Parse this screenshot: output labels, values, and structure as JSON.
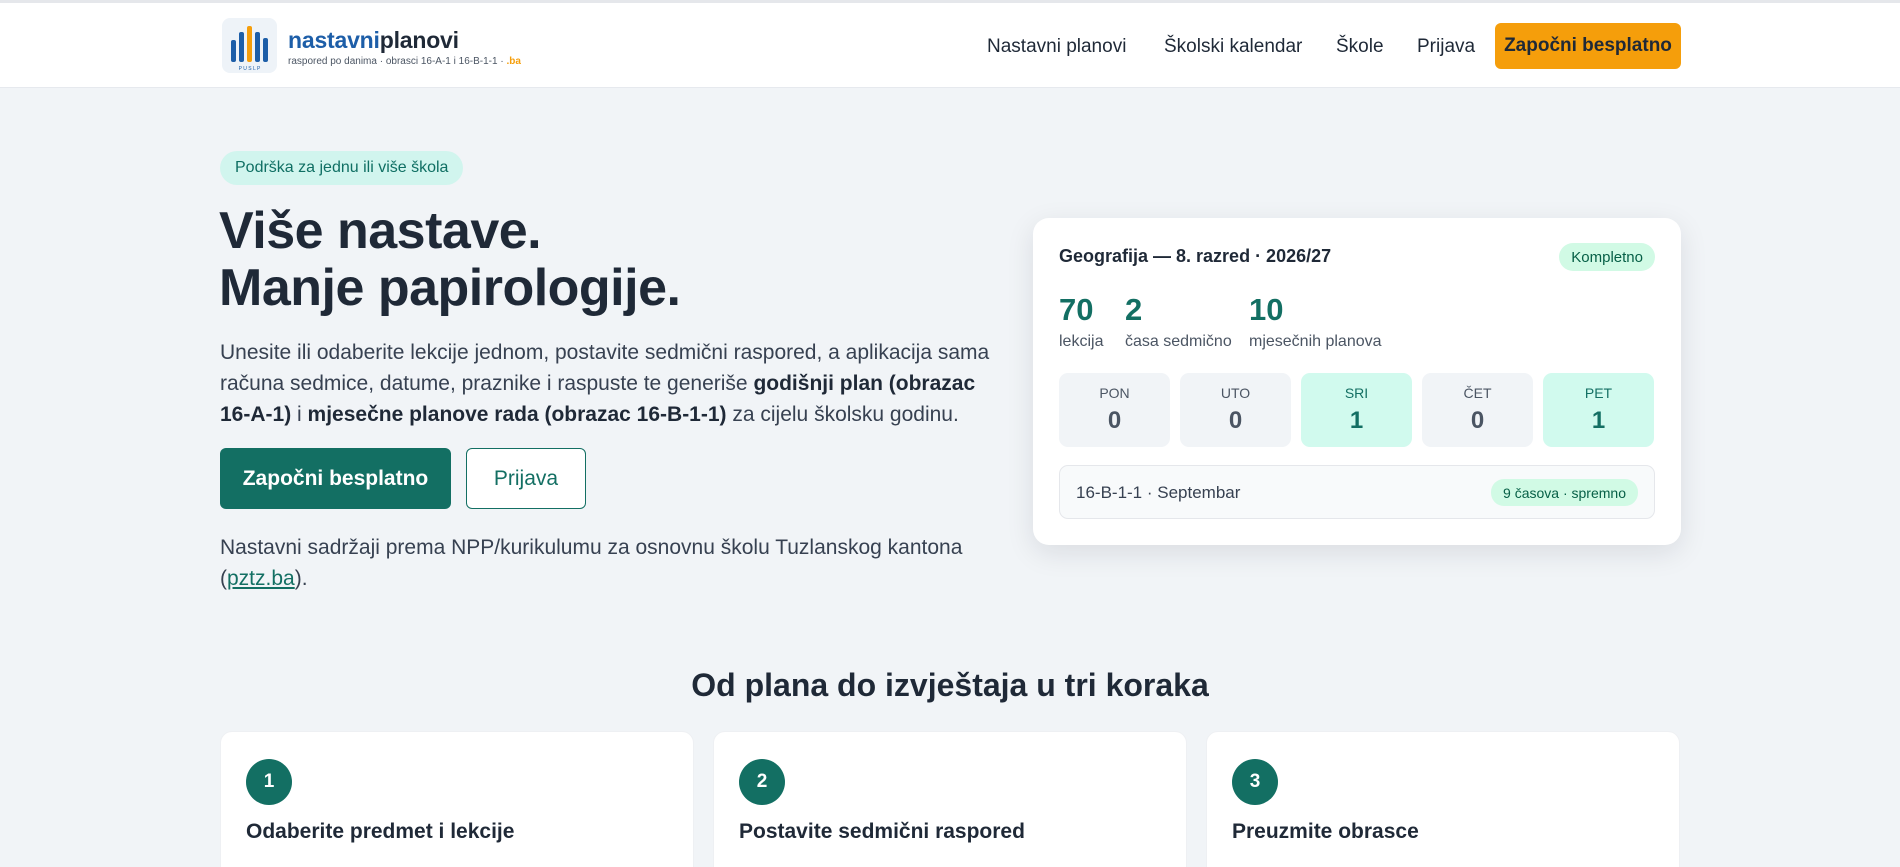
{
  "header": {
    "brand_part1": "nastavni",
    "brand_part2": "planovi",
    "brand_sub": "raspored po danima · obrasci 16-A-1 i 16-B-1-1 ·",
    "brand_tld": ".ba",
    "logo_caption": "P U S L P",
    "nav": [
      "Nastavni planovi",
      "Školski kalendar",
      "Škole",
      "Prijava"
    ],
    "cta": "Započni besplatno"
  },
  "hero": {
    "pill": "Podrška za jednu ili više škola",
    "title_line1": "Više nastave.",
    "title_line2": "Manje papirologije.",
    "desc_part1": "Unesite ili odaberite lekcije jednom, postavite sedmični raspored, a aplikacija sama računa sedmice, datume, praznike i raspuste te generiše ",
    "desc_bold1": "godišnji plan (obrazac 16-A-1)",
    "desc_part2": " i ",
    "desc_bold2": "mjesečne planove rada (obrazac 16-B-1-1)",
    "desc_part3": " za cijelu školsku godinu.",
    "btn_primary": "Započni besplatno",
    "btn_secondary": "Prijava",
    "note_part1": "Nastavni sadržaji prema NPP/kurikulumu za osnovnu školu Tuzlanskog kantona (",
    "note_link": "pztz.ba",
    "note_part2": ")."
  },
  "card": {
    "title": "Geografija — 8. razred · 2026/27",
    "badge": "Kompletno",
    "stats": [
      {
        "value": "70",
        "label": "lekcija"
      },
      {
        "value": "2",
        "label": "časa sedmično"
      },
      {
        "value": "10",
        "label": "mjesečnih planova"
      }
    ],
    "days": [
      {
        "name": "PON",
        "value": "0",
        "active": false
      },
      {
        "name": "UTO",
        "value": "0",
        "active": false
      },
      {
        "name": "SRI",
        "value": "1",
        "active": true
      },
      {
        "name": "ČET",
        "value": "0",
        "active": false
      },
      {
        "name": "PET",
        "value": "1",
        "active": true
      }
    ],
    "plan_label": "16-B-1-1 · Septembar",
    "plan_status": "9 časova · spremno"
  },
  "steps": {
    "title": "Od plana do izvještaja u tri koraka",
    "items": [
      {
        "num": "1",
        "title": "Odaberite predmet i lekcije"
      },
      {
        "num": "2",
        "title": "Postavite sedmični raspored"
      },
      {
        "num": "3",
        "title": "Preuzmite obrasce"
      }
    ]
  },
  "colors": {
    "accent": "#136f63",
    "cta": "#f59e0b",
    "brand_blue": "#1d5ea8",
    "background": "#f1f4f7"
  }
}
